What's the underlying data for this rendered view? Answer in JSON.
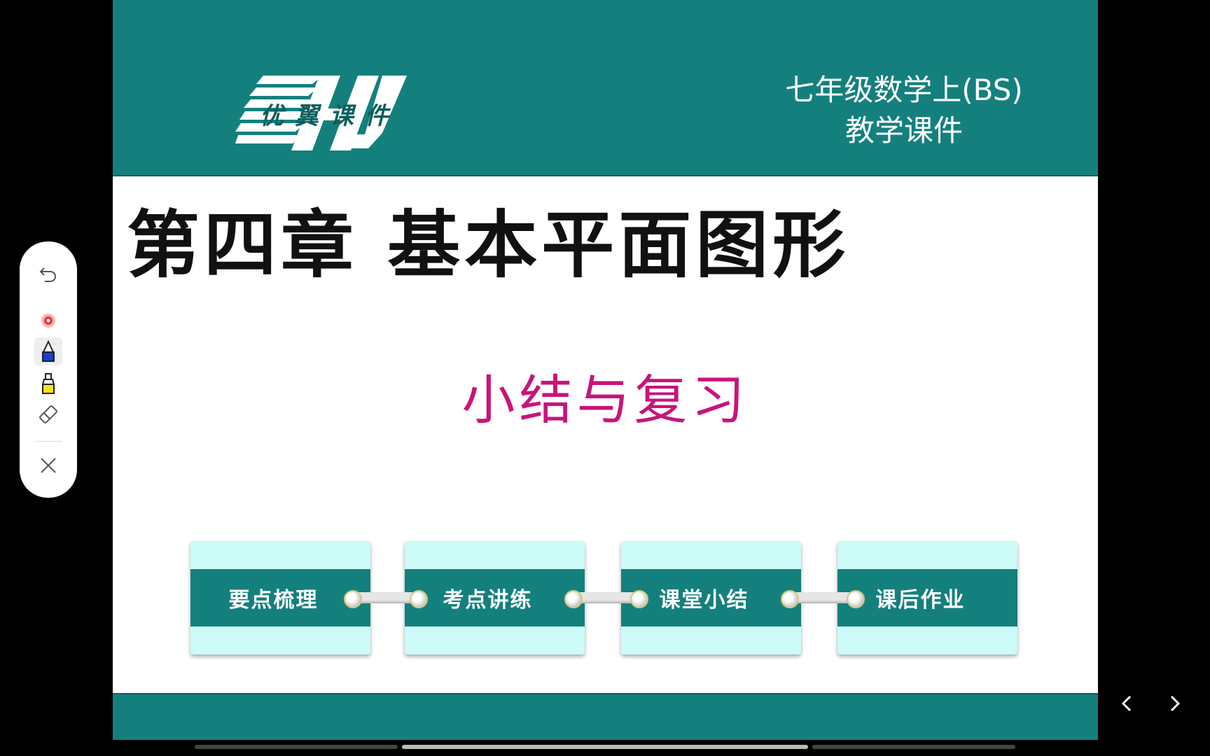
{
  "header": {
    "logo_text": "优翼课件",
    "course_line1": "七年级数学上(BS)",
    "course_line2": "教学课件"
  },
  "slide": {
    "chapter_title": "第四章 基本平面图形",
    "subtitle": "小结与复习"
  },
  "nav_cards": [
    {
      "label": "要点梳理"
    },
    {
      "label": "考点讲练"
    },
    {
      "label": "课堂小结"
    },
    {
      "label": "课后作业"
    }
  ],
  "toolbar": {
    "tools": [
      "undo-icon",
      "laser-pointer-icon",
      "pen-icon",
      "highlighter-icon",
      "eraser-icon",
      "close-icon"
    ],
    "active": "pen-icon"
  },
  "colors": {
    "teal": "#14807d",
    "card_bg": "#ccfbf8",
    "subtitle": "#c8147a",
    "pen": "#1a3fd1",
    "highlighter": "#f5e51b",
    "laser": "#e23a3a"
  },
  "progress": {
    "segments": 3,
    "active_segment": 2
  }
}
